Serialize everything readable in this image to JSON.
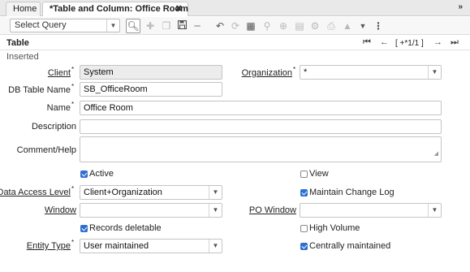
{
  "tabs": {
    "home": "Home",
    "active": "*Table and Column: Office Room",
    "close": "✖",
    "collapse": "»"
  },
  "toolbar": {
    "query_select": "Select Query",
    "icons": [
      "search-icon",
      "new-icon",
      "copy-icon",
      "save-icon",
      "delete-icon",
      "undo-icon",
      "refresh-icon",
      "grid-toggle-icon",
      "attachment-icon",
      "zoom-icon",
      "report-icon",
      "process-icon",
      "print-icon",
      "parent-icon",
      "detail-icon",
      "more-icon"
    ]
  },
  "header": {
    "title": "Table",
    "record_info": "[ +*1/1 ]",
    "status": "Inserted"
  },
  "form": {
    "client": {
      "label": "Client",
      "value": "System"
    },
    "organization": {
      "label": "Organization",
      "value": "*"
    },
    "db_table_name": {
      "label": "DB Table Name",
      "value": "SB_OfficeRoom"
    },
    "name": {
      "label": "Name",
      "value": "Office Room"
    },
    "description": {
      "label": "Description",
      "value": ""
    },
    "comment_help": {
      "label": "Comment/Help",
      "value": ""
    },
    "active": {
      "label": "Active",
      "checked": true
    },
    "view": {
      "label": "View",
      "checked": false
    },
    "data_access_level": {
      "label": "Data Access Level",
      "value": "Client+Organization"
    },
    "maintain_change_log": {
      "label": "Maintain Change Log",
      "checked": true
    },
    "window": {
      "label": "Window",
      "value": ""
    },
    "po_window": {
      "label": "PO Window",
      "value": ""
    },
    "records_deletable": {
      "label": "Records deletable",
      "checked": true
    },
    "high_volume": {
      "label": "High Volume",
      "checked": false
    },
    "entity_type": {
      "label": "Entity Type",
      "value": "User maintained"
    },
    "centrally_maintained": {
      "label": "Centrally maintained",
      "checked": true
    }
  },
  "required_mark": "*",
  "colors": {
    "accent": "#2f6fd1",
    "readonly_bg": "#ececec",
    "tabbar_bg": "#e9e9e9"
  }
}
